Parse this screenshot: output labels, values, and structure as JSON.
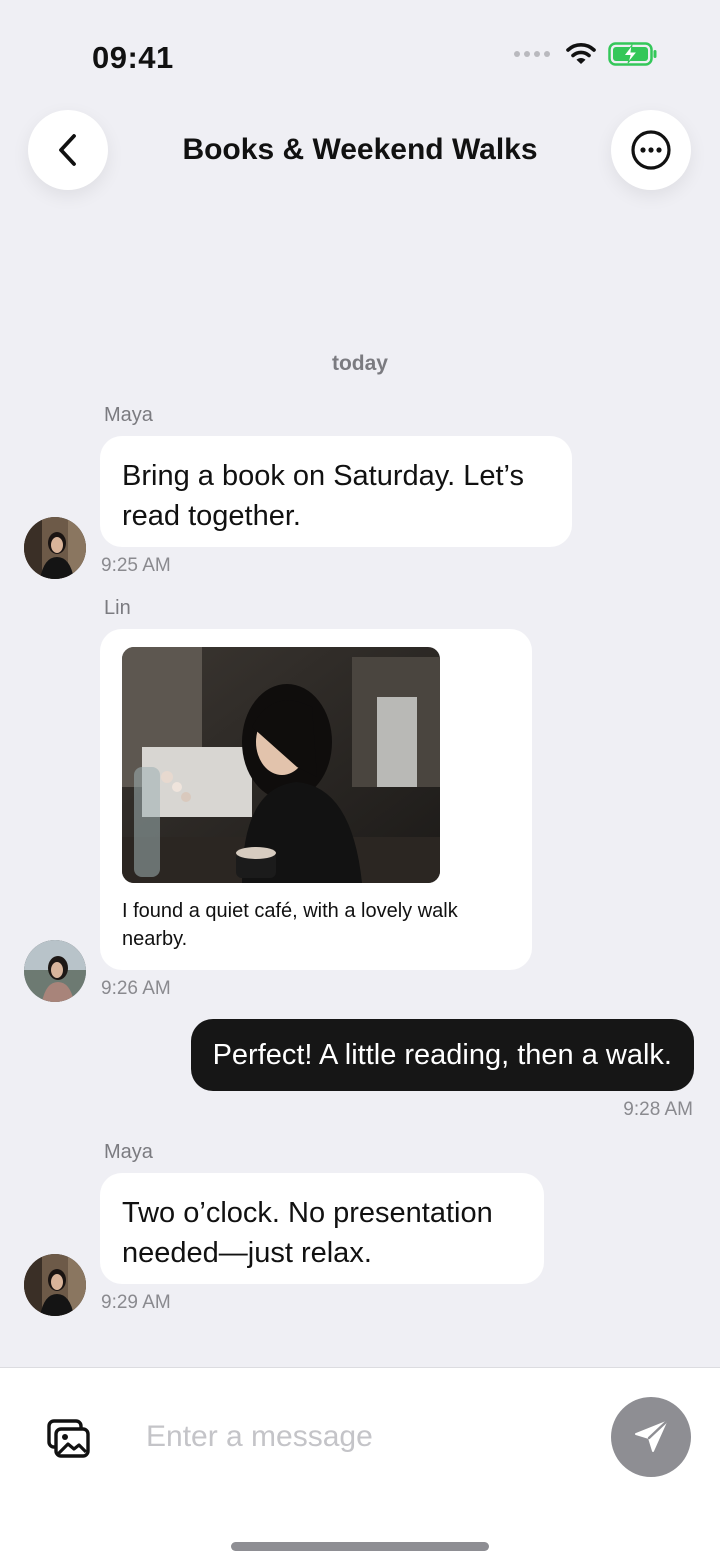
{
  "status_bar": {
    "time": "09:41"
  },
  "header": {
    "title": "Books & Weekend Walks"
  },
  "date_separator": "today",
  "messages": [
    {
      "sender": "Maya",
      "text": "Bring a book on Saturday. Let’s read together.",
      "time": "9:25 AM"
    },
    {
      "sender": "Lin",
      "caption": "I found a quiet café, with a lovely walk nearby.",
      "time": "9:26 AM"
    },
    {
      "text": "Perfect! A little reading, then a walk.",
      "time": "9:28 AM"
    },
    {
      "sender": "Maya",
      "text": "Two o’clock. No presentation needed—just relax.",
      "time": "9:29 AM"
    }
  ],
  "composer": {
    "placeholder": "Enter a message"
  },
  "icons": {
    "back": "chevron-left-icon",
    "more": "ellipsis-circle-icon",
    "gallery": "photo-gallery-icon",
    "send": "paper-plane-icon"
  },
  "colors": {
    "background": "#efeff4",
    "outgoing_bubble": "#161616",
    "incoming_bubble": "#ffffff",
    "send_button": "#8e8e93",
    "battery": "#34c759"
  }
}
